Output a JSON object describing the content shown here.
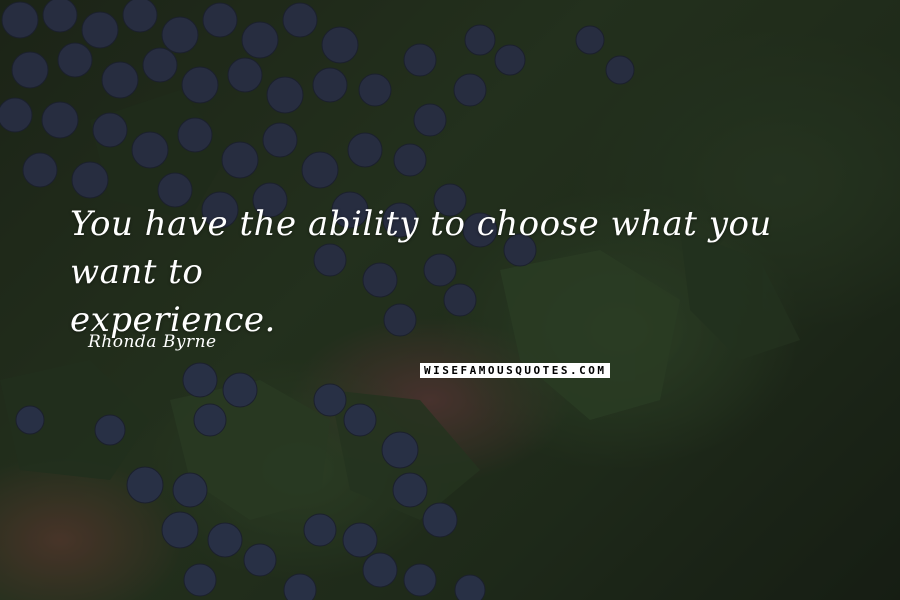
{
  "quote": {
    "line1": "You have the ability to choose what you want to",
    "line2": "experience."
  },
  "author": "Rhonda Byrne",
  "watermark": "WISEFAMOUSQUOTES.COM",
  "colors": {
    "text": "#ffffff",
    "berry": "#3a4466",
    "leaf": "#3e5733"
  }
}
